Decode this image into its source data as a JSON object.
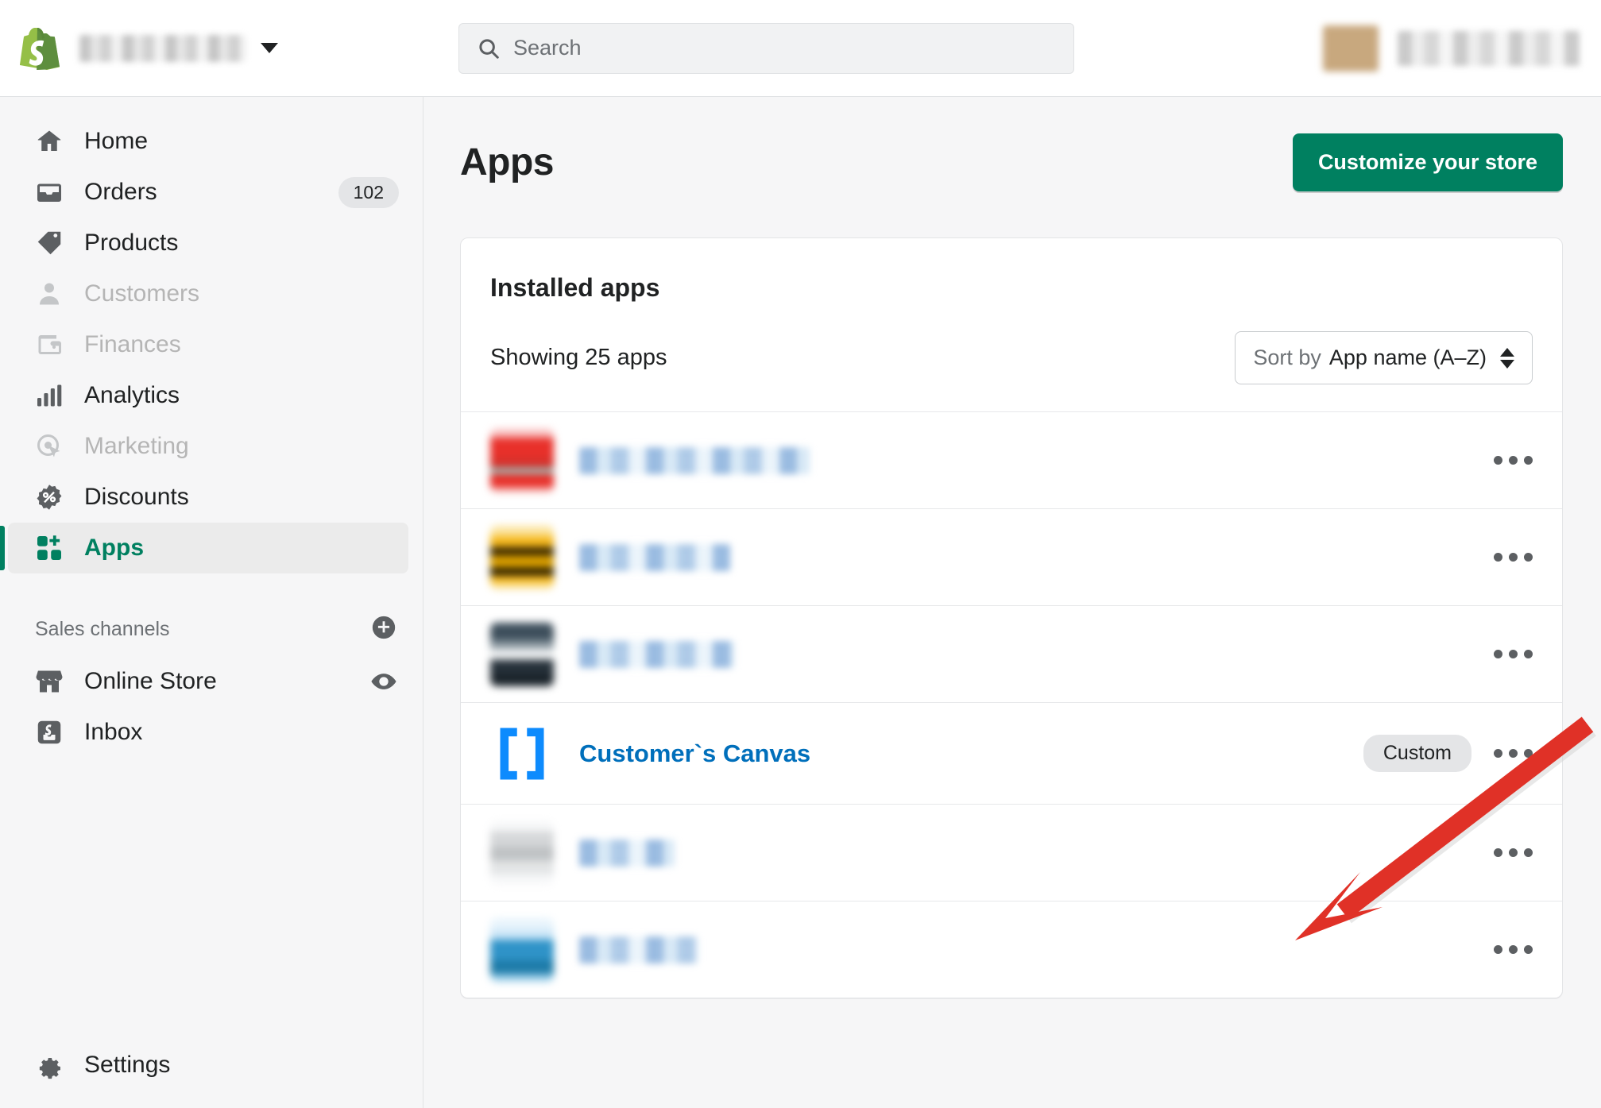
{
  "topbar": {
    "logo_icon": "shopify-bag-icon",
    "store_name": "",
    "store_caret_icon": "chevron-down-icon",
    "search": {
      "placeholder": "Search",
      "value": "",
      "icon": "search-icon"
    },
    "account": {
      "avatar": "avatar",
      "name": ""
    }
  },
  "sidebar": {
    "items": [
      {
        "label": "Home",
        "icon": "home-icon",
        "state": "normal",
        "badge": ""
      },
      {
        "label": "Orders",
        "icon": "orders-icon",
        "state": "normal",
        "badge": "102"
      },
      {
        "label": "Products",
        "icon": "products-icon",
        "state": "normal",
        "badge": ""
      },
      {
        "label": "Customers",
        "icon": "customers-icon",
        "state": "disabled",
        "badge": ""
      },
      {
        "label": "Finances",
        "icon": "finances-icon",
        "state": "disabled",
        "badge": ""
      },
      {
        "label": "Analytics",
        "icon": "analytics-icon",
        "state": "normal",
        "badge": ""
      },
      {
        "label": "Marketing",
        "icon": "marketing-icon",
        "state": "disabled",
        "badge": ""
      },
      {
        "label": "Discounts",
        "icon": "discounts-icon",
        "state": "normal",
        "badge": ""
      },
      {
        "label": "Apps",
        "icon": "apps-icon",
        "state": "active",
        "badge": ""
      }
    ],
    "sales_channels": {
      "label": "Sales channels",
      "add_icon": "circle-plus-icon",
      "items": [
        {
          "label": "Online Store",
          "icon": "storefront-icon",
          "action_icon": "eye-icon"
        },
        {
          "label": "Inbox",
          "icon": "shopify-inbox-icon",
          "action_icon": ""
        }
      ]
    },
    "settings": {
      "label": "Settings",
      "icon": "gear-icon"
    }
  },
  "main": {
    "page_title": "Apps",
    "primary_button": "Customize your store",
    "card": {
      "title": "Installed apps",
      "showing": "Showing 25 apps",
      "sort": {
        "label": "Sort by",
        "value": "App name (A–Z)",
        "caret_icon": "sort-caret-icon"
      },
      "rows": [
        {
          "name": "",
          "blurred": true,
          "icon_colors": [
            "#f9c1c1",
            "#e8302a",
            "#d6312b",
            "#8fd6d2"
          ],
          "badge": "",
          "menu_icon": "more-actions-icon"
        },
        {
          "name": "",
          "blurred": true,
          "icon_colors": [
            "#fbe4a0",
            "#f5b71a",
            "#d99e00",
            "#1c1400"
          ],
          "badge": "",
          "menu_icon": "more-actions-icon"
        },
        {
          "name": "",
          "blurred": true,
          "icon_colors": [
            "#3e4f5c",
            "#26313a",
            "#8e9ba3",
            "#f3f5f6"
          ],
          "badge": "",
          "menu_icon": "more-actions-icon"
        },
        {
          "name": "Customer`s Canvas",
          "blurred": false,
          "icon": "bracket-icon",
          "icon_color": "#0d8bfd",
          "badge": "Custom",
          "menu_icon": "more-actions-icon"
        },
        {
          "name": "",
          "blurred": true,
          "icon_colors": [
            "#f2f3f4",
            "#d5d7d9",
            "#bfc2c4",
            "#eeeff0"
          ],
          "badge": "",
          "menu_icon": "more-actions-icon"
        },
        {
          "name": "",
          "blurred": true,
          "icon_colors": [
            "#cbe6f7",
            "#2f93c8",
            "#1d7ba8",
            "#9ed0ea"
          ],
          "badge": "",
          "menu_icon": "more-actions-icon"
        }
      ]
    }
  },
  "annotation": {
    "arrow_color": "#e03127",
    "target": "Customer`s Canvas"
  },
  "colors": {
    "brand_green": "#008060",
    "link_blue": "#006fbb",
    "app_icon_blue": "#0d8bfd",
    "sidebar_bg": "#f6f6f7",
    "text": "#202223",
    "muted_text": "#6d7175",
    "disabled_text": "#b5b5b5"
  }
}
